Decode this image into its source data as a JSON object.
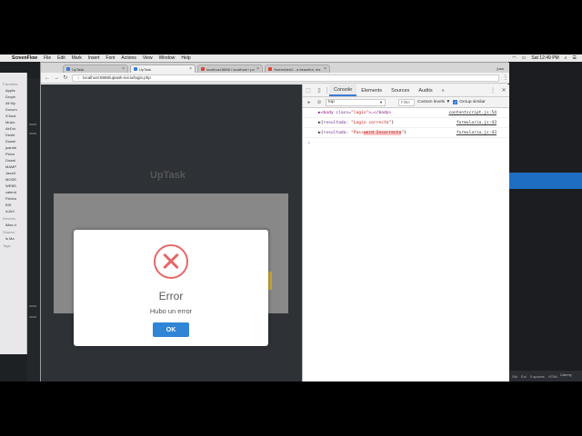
{
  "menubar": {
    "apple": "",
    "app": "ScreenFlow",
    "items": [
      "File",
      "Edit",
      "Mark",
      "Insert",
      "Font",
      "Actions",
      "View",
      "Window",
      "Help"
    ],
    "clock": "Sat 12:49 PM"
  },
  "finder": {
    "sections": [
      {
        "title": "Favorites",
        "items": [
          "Applic",
          "Dropb",
          "All My",
          "Docum",
          "iCloud",
          "Music",
          "AirDro",
          "Deskt",
          "Downl",
          "juande",
          "Pictur",
          "Downl",
          "MAMP",
          "JavaS",
          "MODE",
          "WEBS",
          "calend",
          "Flexbo",
          "BIS",
          "AJAX"
        ]
      },
      {
        "title": "Devices",
        "items": [
          "iMac d"
        ]
      },
      {
        "title": "Shared",
        "items": [
          "ls Ma"
        ]
      },
      {
        "title": "Tags",
        "items": []
      }
    ]
  },
  "browser": {
    "tabs": [
      {
        "title": "UpTask",
        "active": false
      },
      {
        "title": "UpTask",
        "active": true
      },
      {
        "title": "localhost:8888 / localhost / po",
        "active": false
      },
      {
        "title": "SweetAlert2 - a beautiful, res",
        "active": false
      }
    ],
    "user": "juan",
    "url": "localhost:8888/uptask-inicio/login.php"
  },
  "page": {
    "logo": "UpTask",
    "modal": {
      "title": "Error",
      "text": "Hubo un error",
      "ok_label": "OK"
    }
  },
  "devtools": {
    "tabs": [
      "Console",
      "Elements",
      "Sources",
      "Audits",
      "»"
    ],
    "active_tab": "Console",
    "context": "top",
    "filter_placeholder": "Filter",
    "levels": "Custom levels ▼",
    "group_similar": "Group similar",
    "logs": [
      {
        "pre": "▶<",
        "tag": "body",
        "attr": " class=",
        "val": "\"login\"",
        "post": ">…</body>",
        "src": "contentscript.js:54"
      },
      {
        "pre": "▶{",
        "key": "resultado",
        "mid": ": ",
        "val": "\"Login correcto\"",
        "post": "}",
        "src": "formulario.js:43"
      },
      {
        "pre": "▶{",
        "key": "resultado",
        "mid": ": ",
        "val1": "\"Pass",
        "val_hl": "word Incorrecto",
        "val2": "\"",
        "post": "}",
        "src": "formulario.js:43"
      }
    ],
    "prompt": "›"
  },
  "watermark": "Udemy",
  "status_bar": [
    "Sbt",
    "Ext",
    "0 spaces",
    "HTML"
  ]
}
